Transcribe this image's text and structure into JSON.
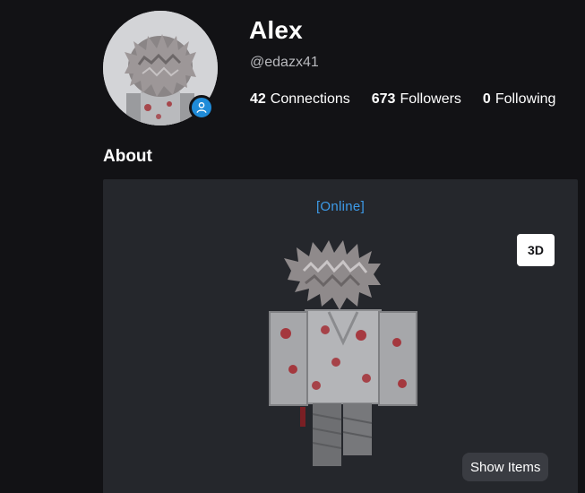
{
  "profile": {
    "display_name": "Alex",
    "username": "@edazx41",
    "status_color": "#1f8bd8"
  },
  "stats": [
    {
      "count": "42",
      "label": "Connections"
    },
    {
      "count": "673",
      "label": "Followers"
    },
    {
      "count": "0",
      "label": "Following"
    }
  ],
  "about": {
    "heading": "About",
    "presence": "[Online]",
    "view_toggle_label": "3D",
    "show_items_label": "Show Items"
  },
  "colors": {
    "background": "#121215",
    "panel": "#25272c",
    "online_accent": "#3d9be9",
    "badge_blue": "#1f8bd8"
  },
  "icons": {
    "status_badge": "user-icon"
  }
}
